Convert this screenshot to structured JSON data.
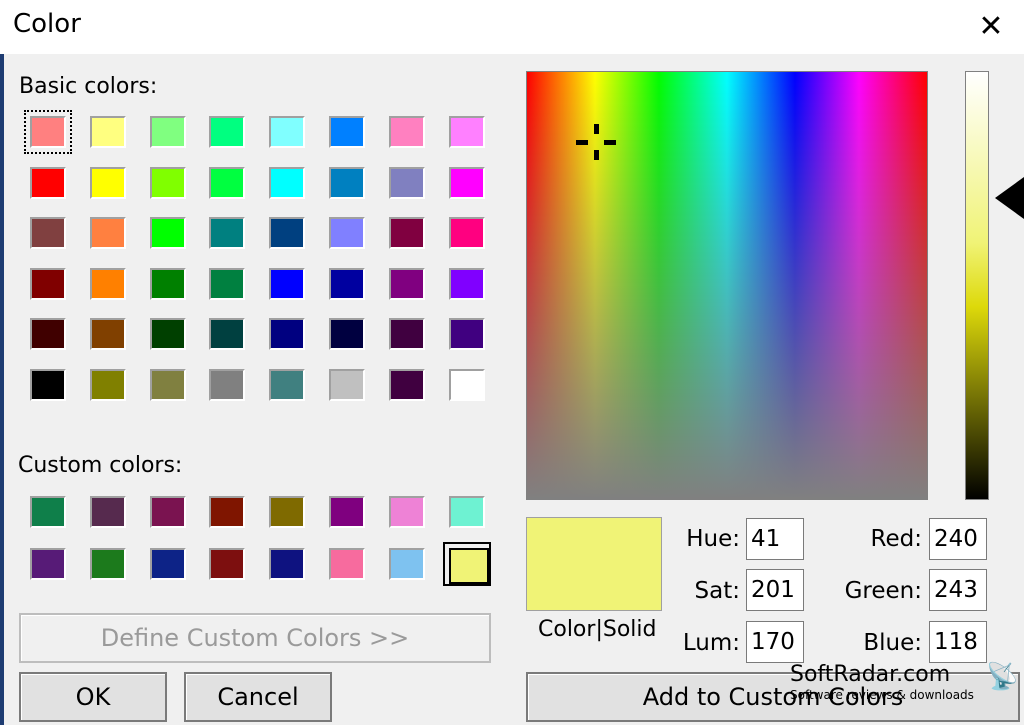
{
  "window": {
    "title": "Color",
    "close_glyph": "✕"
  },
  "basic_colors": {
    "label": "Basic colors:",
    "swatches": [
      "#ff8080",
      "#ffff80",
      "#80ff80",
      "#00ff80",
      "#80ffff",
      "#0080ff",
      "#ff80c0",
      "#ff80ff",
      "#ff0000",
      "#ffff00",
      "#80ff00",
      "#00ff40",
      "#00ffff",
      "#0080c0",
      "#8080c0",
      "#ff00ff",
      "#804040",
      "#ff8040",
      "#00ff00",
      "#008080",
      "#004080",
      "#8080ff",
      "#800040",
      "#ff0080",
      "#800000",
      "#ff8000",
      "#008000",
      "#008040",
      "#0000ff",
      "#0000a0",
      "#800080",
      "#8000ff",
      "#400000",
      "#804000",
      "#004000",
      "#004040",
      "#000080",
      "#000040",
      "#400040",
      "#400080",
      "#000000",
      "#808000",
      "#808040",
      "#808080",
      "#408080",
      "#c0c0c0",
      "#400040",
      "#ffffff"
    ]
  },
  "custom_colors": {
    "label": "Custom colors:",
    "swatches": [
      "#0f7f4a",
      "#562a4e",
      "#7a1350",
      "#7f1500",
      "#7f6a00",
      "#7f007f",
      "#ee82d6",
      "#6ef2d2",
      "#571b77",
      "#1c7a1c",
      "#0d2387",
      "#7d0f0f",
      "#0e1280",
      "#f76b9e",
      "#7ec2f0",
      "#f0f376"
    ]
  },
  "buttons": {
    "define_custom": "Define Custom Colors >>",
    "ok": "OK",
    "cancel": "Cancel",
    "add_custom": "Add to Custom Colors"
  },
  "preview": {
    "label": "Color|Solid",
    "color": "#f0f376"
  },
  "fields": {
    "hue": {
      "label": "Hue:",
      "value": "41"
    },
    "sat": {
      "label": "Sat:",
      "value": "201"
    },
    "lum": {
      "label": "Lum:",
      "value": "170"
    },
    "red": {
      "label": "Red:",
      "value": "240"
    },
    "green": {
      "label": "Green:",
      "value": "243"
    },
    "blue": {
      "label": "Blue:",
      "value": "118"
    }
  },
  "watermark": {
    "main": "SoftRadar.com",
    "sub": "Software reviews & downloads",
    "icon": "satellite-dish-icon"
  }
}
